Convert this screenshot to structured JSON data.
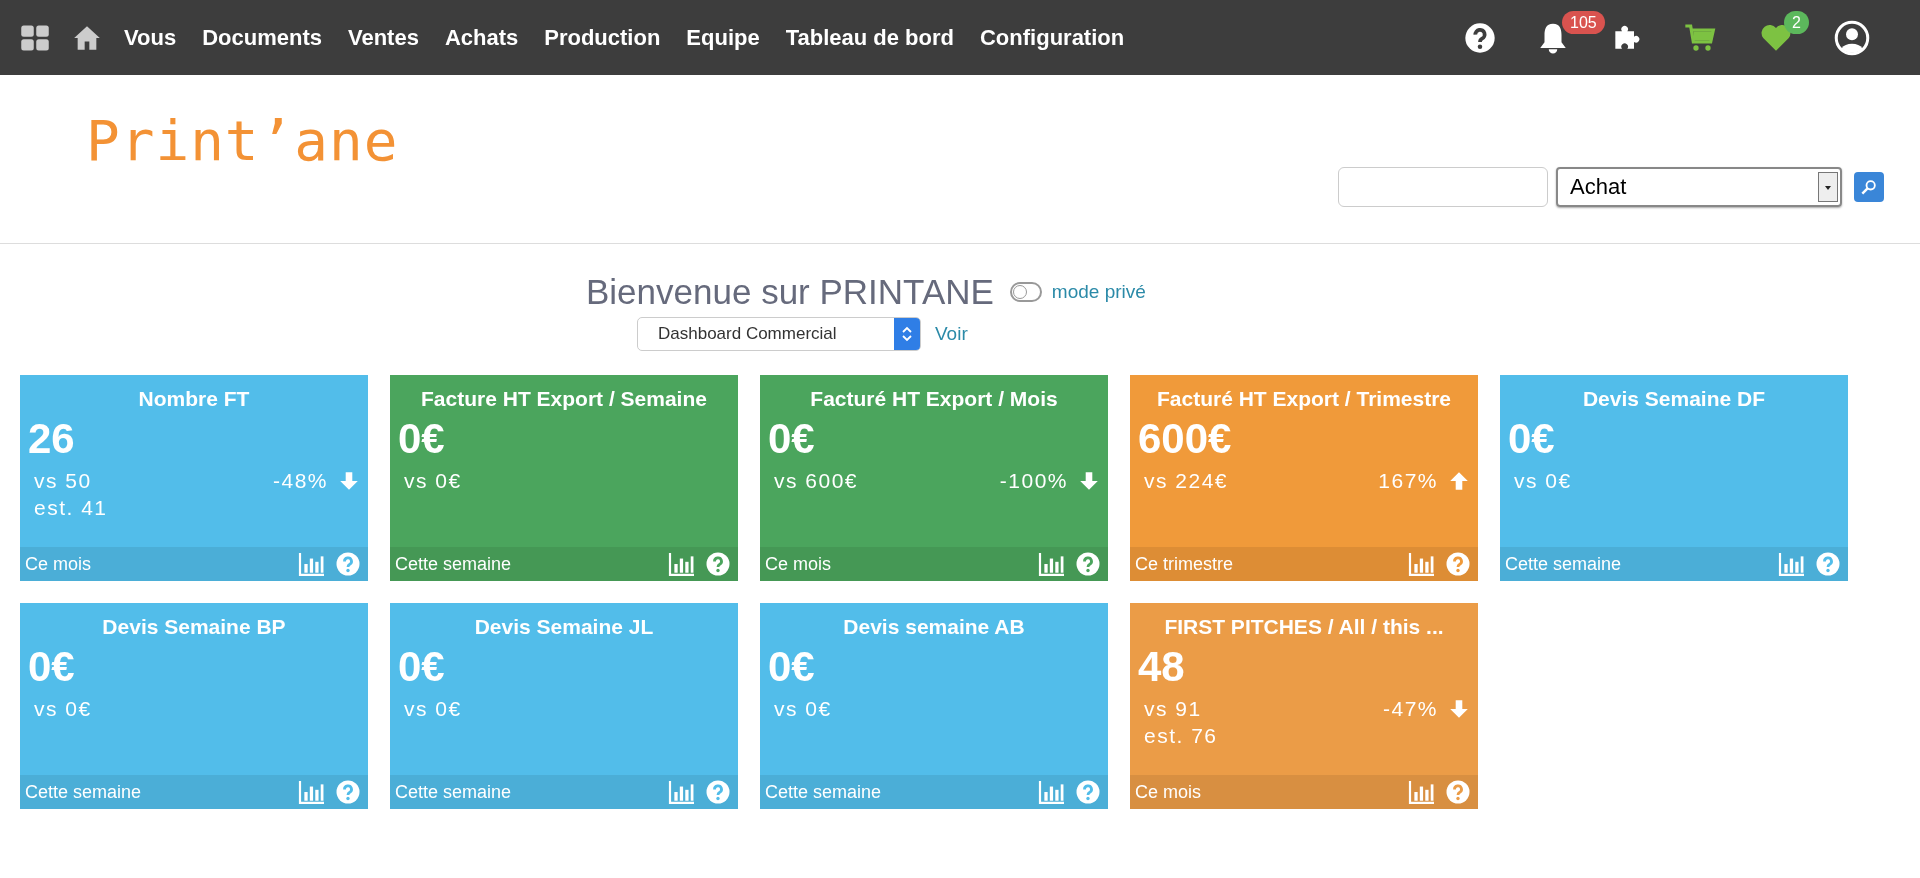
{
  "navbar": {
    "menu": [
      "Vous",
      "Documents",
      "Ventes",
      "Achats",
      "Production",
      "Equipe",
      "Tableau de bord",
      "Configuration"
    ],
    "notifications_badge": "105",
    "favorites_badge": "2"
  },
  "header": {
    "logo": "Print’ane",
    "search_select": "Achat"
  },
  "welcome": {
    "title": "Bienvenue sur PRINTANE",
    "private_mode": {
      "label": "mode privé",
      "on": false
    },
    "dashboard_select": "Dashboard Commercial",
    "view_link": "Voir"
  },
  "tiles": [
    {
      "title": "Nombre FT",
      "value": "26",
      "compare": "vs 50",
      "estimate": "est. 41",
      "change": "-48%",
      "rising": false,
      "period": "Ce mois",
      "color": "#52bdea"
    },
    {
      "title": "Facture HT Export / Semaine",
      "value": "0€",
      "compare": "vs 0€",
      "period": "Cette semaine",
      "color": "#4ba55d"
    },
    {
      "title": "Facturé HT Export / Mois",
      "value": "0€",
      "compare": "vs 600€",
      "change": "-100%",
      "rising": false,
      "period": "Ce mois",
      "color": "#4ba55d"
    },
    {
      "title": "Facturé HT Export / Trimestre",
      "value": "600€",
      "compare": "vs 224€",
      "change": "167%",
      "rising": true,
      "period": "Ce trimestre",
      "color": "#f09a3a"
    },
    {
      "title": "Devis Semaine DF",
      "value": "0€",
      "compare": "vs 0€",
      "period": "Cette semaine",
      "color": "#52bdea"
    },
    {
      "title": "Devis Semaine BP",
      "value": "0€",
      "compare": "vs 0€",
      "period": "Cette semaine",
      "color": "#52bdea"
    },
    {
      "title": "Devis Semaine JL",
      "value": "0€",
      "compare": "vs 0€",
      "period": "Cette semaine",
      "color": "#52bdea"
    },
    {
      "title": "Devis semaine AB",
      "value": "0€",
      "compare": "vs 0€",
      "period": "Cette semaine",
      "color": "#52bdea"
    },
    {
      "title": "FIRST PITCHES / All / this ...",
      "value": "48",
      "compare": "vs 91",
      "estimate": "est. 76",
      "change": "-47%",
      "rising": false,
      "period": "Ce mois",
      "color": "#eb9c47"
    }
  ]
}
